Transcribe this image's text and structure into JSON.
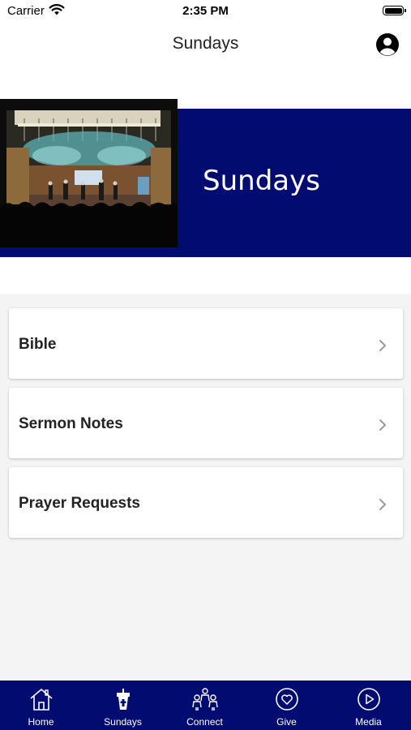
{
  "status_bar": {
    "carrier": "Carrier",
    "time": "2:35 PM"
  },
  "nav": {
    "title": "Sundays"
  },
  "hero": {
    "title": "Sundays"
  },
  "menu": [
    {
      "label": "Bible"
    },
    {
      "label": "Sermon Notes"
    },
    {
      "label": "Prayer Requests"
    }
  ],
  "tabs": [
    {
      "label": "Home",
      "icon": "home-icon"
    },
    {
      "label": "Sundays",
      "icon": "podium-icon"
    },
    {
      "label": "Connect",
      "icon": "people-icon"
    },
    {
      "label": "Give",
      "icon": "heart-icon"
    },
    {
      "label": "Media",
      "icon": "play-icon"
    }
  ],
  "colors": {
    "brand": "#020c70",
    "background": "#f4f4f4",
    "card": "#ffffff",
    "text": "#222222"
  }
}
